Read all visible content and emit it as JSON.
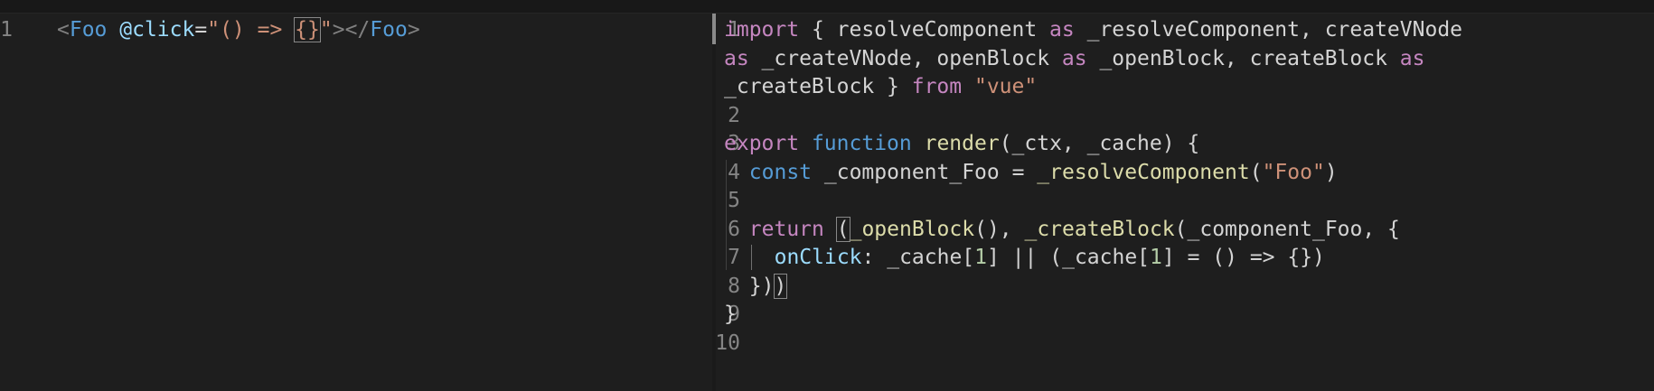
{
  "left_editor": {
    "lines": [
      {
        "n": "1",
        "tokens": [
          {
            "t": "<",
            "c": "punct"
          },
          {
            "t": "Foo",
            "c": "tag"
          },
          {
            "t": " ",
            "c": "plain"
          },
          {
            "t": "@click",
            "c": "attr"
          },
          {
            "t": "=",
            "c": "plain"
          },
          {
            "t": "\"() => ",
            "c": "str"
          },
          {
            "t": "{}",
            "c": "str",
            "box": true
          },
          {
            "t": "\"",
            "c": "str"
          },
          {
            "t": "></",
            "c": "punct"
          },
          {
            "t": "Foo",
            "c": "tag"
          },
          {
            "t": ">",
            "c": "punct"
          }
        ]
      }
    ]
  },
  "right_editor": {
    "lines": [
      {
        "n": "1",
        "tokens": [
          {
            "t": "import",
            "c": "kwc"
          },
          {
            "t": " { resolveComponent ",
            "c": "plain"
          },
          {
            "t": "as",
            "c": "kwc"
          },
          {
            "t": " _resolveComponent, createVNode",
            "c": "plain"
          }
        ]
      },
      {
        "n": "",
        "tokens": [
          {
            "t": "as",
            "c": "kwc"
          },
          {
            "t": " _createVNode, openBlock ",
            "c": "plain"
          },
          {
            "t": "as",
            "c": "kwc"
          },
          {
            "t": " _openBlock, createBlock ",
            "c": "plain"
          },
          {
            "t": "as",
            "c": "kwc"
          }
        ]
      },
      {
        "n": "",
        "tokens": [
          {
            "t": "_createBlock } ",
            "c": "plain"
          },
          {
            "t": "from",
            "c": "kwc"
          },
          {
            "t": " ",
            "c": "plain"
          },
          {
            "t": "\"vue\"",
            "c": "str"
          }
        ]
      },
      {
        "n": "2",
        "tokens": []
      },
      {
        "n": "3",
        "tokens": [
          {
            "t": "export",
            "c": "kwc"
          },
          {
            "t": " ",
            "c": "plain"
          },
          {
            "t": "function",
            "c": "kw"
          },
          {
            "t": " ",
            "c": "plain"
          },
          {
            "t": "render",
            "c": "fn"
          },
          {
            "t": "(_ctx, _cache) {",
            "c": "plain"
          }
        ]
      },
      {
        "n": "4",
        "indent": 1,
        "tokens": [
          {
            "t": "const",
            "c": "kw"
          },
          {
            "t": " _component_Foo = ",
            "c": "plain"
          },
          {
            "t": "_resolveComponent",
            "c": "fn"
          },
          {
            "t": "(",
            "c": "plain"
          },
          {
            "t": "\"Foo\"",
            "c": "str"
          },
          {
            "t": ")",
            "c": "plain"
          }
        ]
      },
      {
        "n": "5",
        "tokens": []
      },
      {
        "n": "6",
        "indent": 1,
        "tokens": [
          {
            "t": "return",
            "c": "kwc"
          },
          {
            "t": " ",
            "c": "plain"
          },
          {
            "t": "(",
            "c": "plain",
            "box": true
          },
          {
            "t": "_openBlock",
            "c": "fn"
          },
          {
            "t": "(), ",
            "c": "plain"
          },
          {
            "t": "_createBlock",
            "c": "fn"
          },
          {
            "t": "(_component_Foo, {",
            "c": "plain"
          }
        ]
      },
      {
        "n": "7",
        "indent": 2,
        "tokens": [
          {
            "t": "onClick",
            "c": "var"
          },
          {
            "t": ": _cache[",
            "c": "plain"
          },
          {
            "t": "1",
            "c": "num"
          },
          {
            "t": "] || (_cache[",
            "c": "plain"
          },
          {
            "t": "1",
            "c": "num"
          },
          {
            "t": "] = () => {})",
            "c": "plain"
          }
        ]
      },
      {
        "n": "8",
        "indent": 1,
        "tokens": [
          {
            "t": "})",
            "c": "plain"
          },
          {
            "t": ")",
            "c": "plain",
            "box": true
          }
        ]
      },
      {
        "n": "9",
        "tokens": [
          {
            "t": "}",
            "c": "plain"
          }
        ]
      },
      {
        "n": "10",
        "tokens": []
      }
    ]
  }
}
